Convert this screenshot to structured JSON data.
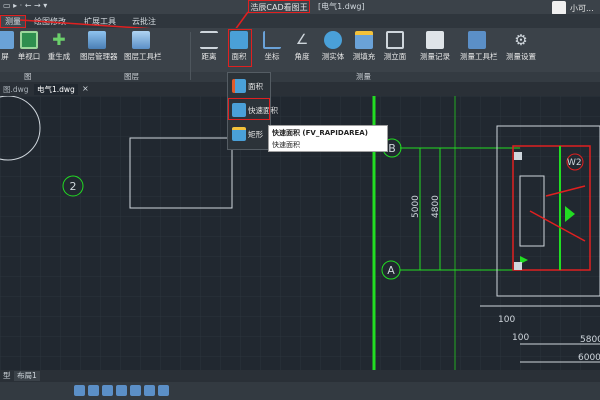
{
  "titlebar": {
    "app_title": "浩辰CAD看图王",
    "doc_title": "[电气1.dwg]",
    "user_name": "小可..."
  },
  "tabs": [
    {
      "label": "测量"
    },
    {
      "label": "绘图修改"
    },
    {
      "label": "扩展工具"
    },
    {
      "label": "云批注"
    }
  ],
  "ribbon": {
    "tools": [
      {
        "label": "屏",
        "icon": "regen-icon"
      },
      {
        "label": "单视口",
        "icon": "single-viewport-icon"
      },
      {
        "label": "重生成",
        "icon": "regenerate-icon"
      },
      {
        "label": "图层管理器",
        "icon": "layer-manager-icon"
      },
      {
        "label": "图层工具栏",
        "icon": "layer-toolbar-icon"
      },
      {
        "label": "距离",
        "icon": "distance-icon"
      },
      {
        "label": "面积",
        "icon": "area-icon"
      },
      {
        "label": "坐标",
        "icon": "coordinate-icon"
      },
      {
        "label": "角度",
        "icon": "angle-icon"
      },
      {
        "label": "测实体",
        "icon": "measure-entity-icon"
      },
      {
        "label": "测填充",
        "icon": "measure-hatch-icon"
      },
      {
        "label": "测立面",
        "icon": "measure-elevation-icon"
      },
      {
        "label": "测量记录",
        "icon": "measure-record-icon"
      },
      {
        "label": "测量工具栏",
        "icon": "measure-toolbar-icon"
      },
      {
        "label": "测量设置",
        "icon": "measure-settings-icon"
      }
    ],
    "groups": [
      {
        "label": "图"
      },
      {
        "label": "图层"
      },
      {
        "label": "测量"
      }
    ]
  },
  "doc_tabs": [
    {
      "label": "图.dwg"
    },
    {
      "label": "电气1.dwg"
    }
  ],
  "dropdown": {
    "items": [
      {
        "label": "面积"
      },
      {
        "label": "快速面积"
      },
      {
        "label": "矩形"
      }
    ]
  },
  "tooltip": {
    "title": "快速面积 (FV_RAPIDAREA)",
    "desc": "快速面积"
  },
  "drawing": {
    "axis_labels": [
      "2",
      "B",
      "A"
    ],
    "dims": [
      "5000",
      "4800",
      "100",
      "100",
      "5800",
      "6000"
    ],
    "room_tag": "W2"
  },
  "layout_tabs": [
    {
      "label": "型"
    },
    {
      "label": "布局1"
    }
  ],
  "colors": {
    "accent_red": "#e02020",
    "canvas": "#212830",
    "green": "#22dd22"
  }
}
